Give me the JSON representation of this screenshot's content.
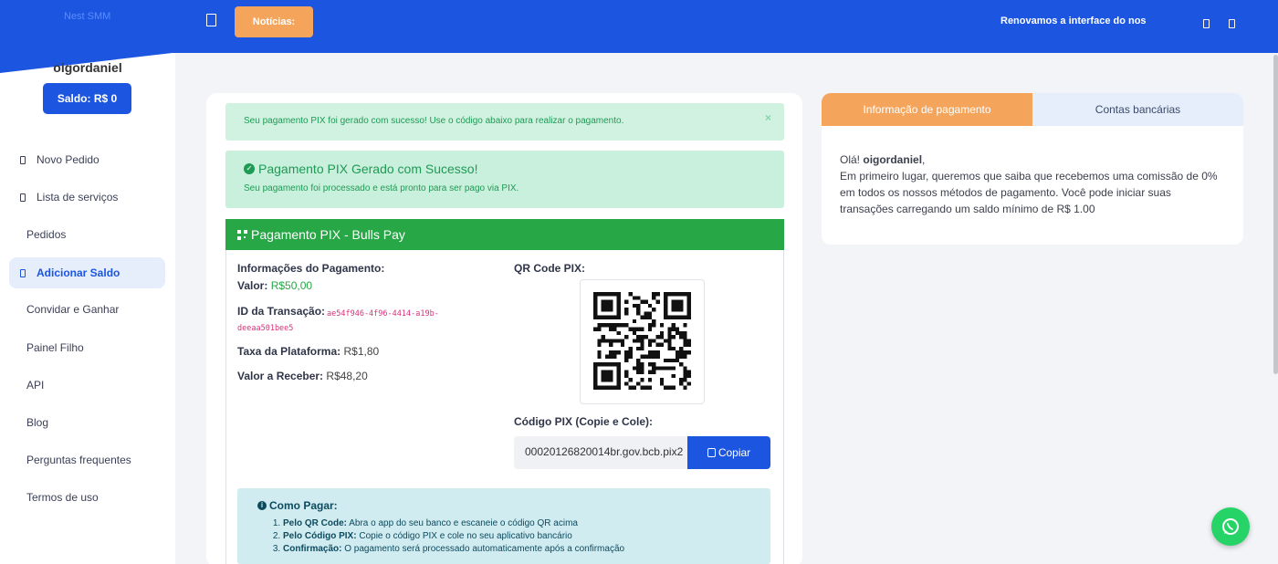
{
  "brand": {
    "logo_text": "Nest SMM"
  },
  "topbar": {
    "news_label": "Notícias:",
    "marquee_text": "Renovamos a interface do nos"
  },
  "user": {
    "username": "oigordaniel",
    "balance_label": "Saldo: R$ 0"
  },
  "sidebar": {
    "items": [
      {
        "label": "Novo Pedido"
      },
      {
        "label": "Lista de serviços"
      },
      {
        "label": "Pedidos"
      },
      {
        "label": "Adicionar Saldo"
      },
      {
        "label": "Convidar e Ganhar"
      },
      {
        "label": "Painel Filho"
      },
      {
        "label": "API"
      },
      {
        "label": "Blog"
      },
      {
        "label": "Perguntas frequentes"
      },
      {
        "label": "Termos de uso"
      }
    ]
  },
  "alerts": {
    "generated": "Seu pagamento PIX foi gerado com sucesso! Use o código abaixo para realizar o pagamento.",
    "close": "×",
    "success_title": "Pagamento PIX Gerado com Sucesso!",
    "success_text": "Seu pagamento foi processado e está pronto para ser pago via PIX."
  },
  "pix": {
    "header": "Pagamento PIX - Bulls Pay",
    "info_title": "Informações do Pagamento:",
    "valor_label": "Valor:",
    "valor": "R$50,00",
    "txid_label": "ID da Transação:",
    "txid": "ae54f946-4f96-4414-a19b-deeaa501bee5",
    "taxa_label": "Taxa da Plataforma:",
    "taxa": "R$1,80",
    "receber_label": "Valor a Receber:",
    "receber": "R$48,20",
    "qr_title": "QR Code PIX:",
    "code_title": "Código PIX (Copie e Cole):",
    "code_value": "00020126820014br.gov.bcb.pix2",
    "copy_label": "Copiar"
  },
  "howto": {
    "title": "Como Pagar:",
    "steps": [
      {
        "bold": "Pelo QR Code:",
        "text": "Abra o app do seu banco e escaneie o código QR acima"
      },
      {
        "bold": "Pelo Código PIX:",
        "text": "Copie o código PIX e cole no seu aplicativo bancário"
      },
      {
        "bold": "Confirmação:",
        "text": "O pagamento será processado automaticamente após a confirmação"
      }
    ]
  },
  "right_panel": {
    "tab_info": "Informação de pagamento",
    "tab_banks": "Contas bancárias",
    "greeting": "Olá!",
    "name": "oigordaniel",
    "comma": ",",
    "body": "Em primeiro lugar, queremos que saiba que recebemos uma comissão de 0% em todos os nossos métodos de pagamento. Você pode iniciar suas transações carregando um saldo mínimo de R$ 1.00"
  },
  "colors": {
    "primary": "#1c55e0",
    "accent": "#f5a55b",
    "success": "#27a745",
    "whatsapp": "#25d366"
  }
}
